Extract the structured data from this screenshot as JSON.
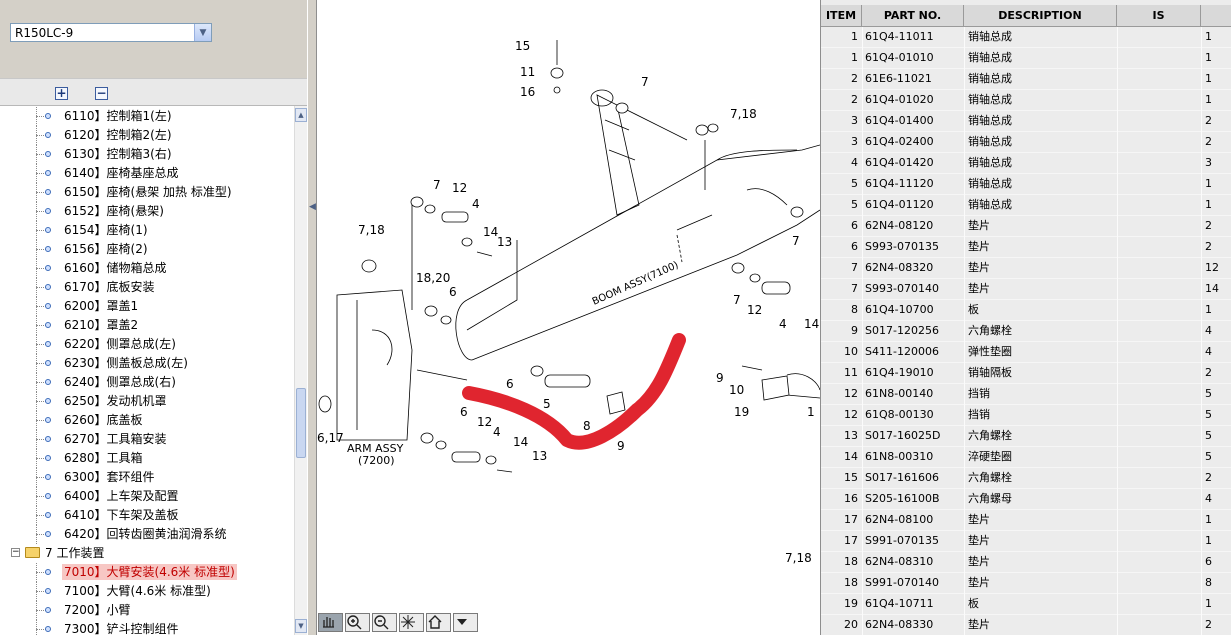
{
  "model_selector": {
    "value": "R150LC-9"
  },
  "tree_toolbar": {
    "expand_label": "+",
    "collapse_label": "−"
  },
  "tree": {
    "items": [
      {
        "label": "6110】控制箱1(左)"
      },
      {
        "label": "6120】控制箱2(左)"
      },
      {
        "label": "6130】控制箱3(右)"
      },
      {
        "label": "6140】座椅基座总成"
      },
      {
        "label": "6150】座椅(悬架 加热 标准型)"
      },
      {
        "label": "6152】座椅(悬架)"
      },
      {
        "label": "6154】座椅(1)"
      },
      {
        "label": "6156】座椅(2)"
      },
      {
        "label": "6160】储物箱总成"
      },
      {
        "label": "6170】底板安装"
      },
      {
        "label": "6200】罩盖1"
      },
      {
        "label": "6210】罩盖2"
      },
      {
        "label": "6220】侧罩总成(左)"
      },
      {
        "label": "6230】侧盖板总成(左)"
      },
      {
        "label": "6240】侧罩总成(右)"
      },
      {
        "label": "6250】发动机机罩"
      },
      {
        "label": "6260】底盖板"
      },
      {
        "label": "6270】工具箱安装"
      },
      {
        "label": "6280】工具箱"
      },
      {
        "label": "6300】套环组件"
      },
      {
        "label": "6400】上车架及配置"
      },
      {
        "label": "6410】下车架及盖板"
      },
      {
        "label": "6420】回转齿圈黄油润滑系统"
      }
    ],
    "folder": {
      "label": "7 工作装置",
      "expander": "−"
    },
    "sub_items": [
      {
        "label": "7010】大臂安装(4.6米 标准型)",
        "selected": true
      },
      {
        "label": "7100】大臂(4.6米 标准型)"
      },
      {
        "label": "7200】小臂"
      },
      {
        "label": "7300】铲斗控制组件"
      }
    ]
  },
  "drawing": {
    "labels": {
      "boom": "BOOM ASSY(7100)",
      "arm": "ARM ASSY",
      "arm_code": "(7200)"
    },
    "callouts": [
      {
        "text": "15"
      },
      {
        "text": "11"
      },
      {
        "text": "16"
      },
      {
        "text": "7"
      },
      {
        "text": "7,18"
      },
      {
        "text": "7"
      },
      {
        "text": "12"
      },
      {
        "text": "4"
      },
      {
        "text": "14"
      },
      {
        "text": "13"
      },
      {
        "text": "7,18"
      },
      {
        "text": "18,20"
      },
      {
        "text": "6"
      },
      {
        "text": "7"
      },
      {
        "text": "7"
      },
      {
        "text": "12"
      },
      {
        "text": "4"
      },
      {
        "text": "14"
      },
      {
        "text": "6"
      },
      {
        "text": "5"
      },
      {
        "text": "6"
      },
      {
        "text": "12"
      },
      {
        "text": "4"
      },
      {
        "text": "14"
      },
      {
        "text": "13"
      },
      {
        "text": "8"
      },
      {
        "text": "9"
      },
      {
        "text": "9"
      },
      {
        "text": "10"
      },
      {
        "text": "19"
      },
      {
        "text": "1"
      },
      {
        "text": "6,17"
      },
      {
        "text": "7,18"
      }
    ],
    "annotation_color": "#e0252f"
  },
  "view_toolbar": {
    "buttons": [
      {
        "icon": "pan-hand-icon"
      },
      {
        "icon": "zoom-in-icon"
      },
      {
        "icon": "zoom-out-icon"
      },
      {
        "icon": "select-sparkle-icon"
      },
      {
        "icon": "home-icon"
      },
      {
        "icon": "dropdown-arrow-icon"
      }
    ]
  },
  "parts_table": {
    "headers": {
      "item": "ITEM",
      "part_no": "PART NO.",
      "description": "DESCRIPTION",
      "is": "IS"
    },
    "rows": [
      {
        "item": "1",
        "part_no": "61Q4-11011",
        "description": "销轴总成",
        "is": "1"
      },
      {
        "item": "1",
        "part_no": "61Q4-01010",
        "description": "销轴总成",
        "is": "1"
      },
      {
        "item": "2",
        "part_no": "61E6-11021",
        "description": "销轴总成",
        "is": "1"
      },
      {
        "item": "2",
        "part_no": "61Q4-01020",
        "description": "销轴总成",
        "is": "1"
      },
      {
        "item": "3",
        "part_no": "61Q4-01400",
        "description": "销轴总成",
        "is": "2"
      },
      {
        "item": "3",
        "part_no": "61Q4-02400",
        "description": "销轴总成",
        "is": "2"
      },
      {
        "item": "4",
        "part_no": "61Q4-01420",
        "description": "销轴总成",
        "is": "3"
      },
      {
        "item": "5",
        "part_no": "61Q4-11120",
        "description": "销轴总成",
        "is": "1"
      },
      {
        "item": "5",
        "part_no": "61Q4-01120",
        "description": "销轴总成",
        "is": "1"
      },
      {
        "item": "6",
        "part_no": "62N4-08120",
        "description": "垫片",
        "is": "2"
      },
      {
        "item": "6",
        "part_no": "S993-070135",
        "description": "垫片",
        "is": "2"
      },
      {
        "item": "7",
        "part_no": "62N4-08320",
        "description": "垫片",
        "is": "12"
      },
      {
        "item": "7",
        "part_no": "S993-070140",
        "description": "垫片",
        "is": "14"
      },
      {
        "item": "8",
        "part_no": "61Q4-10700",
        "description": "板",
        "is": "1"
      },
      {
        "item": "9",
        "part_no": "S017-120256",
        "description": "六角螺栓",
        "is": "4"
      },
      {
        "item": "10",
        "part_no": "S411-120006",
        "description": "弹性垫圈",
        "is": "4"
      },
      {
        "item": "11",
        "part_no": "61Q4-19010",
        "description": "销轴隔板",
        "is": "2"
      },
      {
        "item": "12",
        "part_no": "61N8-00140",
        "description": "挡销",
        "is": "5"
      },
      {
        "item": "12",
        "part_no": "61Q8-00130",
        "description": "挡销",
        "is": "5"
      },
      {
        "item": "13",
        "part_no": "S017-16025D",
        "description": "六角螺栓",
        "is": "5"
      },
      {
        "item": "14",
        "part_no": "61N8-00310",
        "description": "淬硬垫圈",
        "is": "5"
      },
      {
        "item": "15",
        "part_no": "S017-161606",
        "description": "六角螺栓",
        "is": "2"
      },
      {
        "item": "16",
        "part_no": "S205-16100B",
        "description": "六角螺母",
        "is": "4"
      },
      {
        "item": "17",
        "part_no": "62N4-08100",
        "description": "垫片",
        "is": "1"
      },
      {
        "item": "17",
        "part_no": "S991-070135",
        "description": "垫片",
        "is": "1"
      },
      {
        "item": "18",
        "part_no": "62N4-08310",
        "description": "垫片",
        "is": "6"
      },
      {
        "item": "18",
        "part_no": "S991-070140",
        "description": "垫片",
        "is": "8"
      },
      {
        "item": "19",
        "part_no": "61Q4-10711",
        "description": "板",
        "is": "1"
      },
      {
        "item": "20",
        "part_no": "62N4-08330",
        "description": "垫片",
        "is": "2"
      }
    ]
  }
}
